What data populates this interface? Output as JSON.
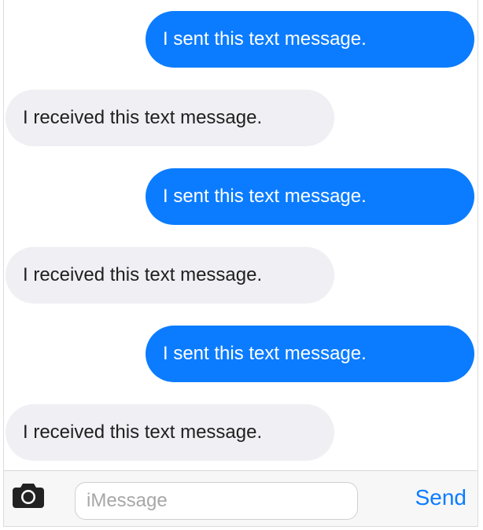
{
  "messages": [
    {
      "direction": "sent",
      "text": "I sent this text message."
    },
    {
      "direction": "received",
      "text": "I received this text message."
    },
    {
      "direction": "sent",
      "text": "I sent this text message."
    },
    {
      "direction": "received",
      "text": "I received this text message."
    },
    {
      "direction": "sent",
      "text": "I sent this text message."
    },
    {
      "direction": "received",
      "text": "I received this text message."
    }
  ],
  "composer": {
    "camera_icon": "camera-icon",
    "input_placeholder": "iMessage",
    "input_value": "",
    "send_label": "Send"
  },
  "colors": {
    "sent_bubble": "#0b7cff",
    "received_bubble": "#efeff4",
    "accent": "#0b7cff"
  }
}
